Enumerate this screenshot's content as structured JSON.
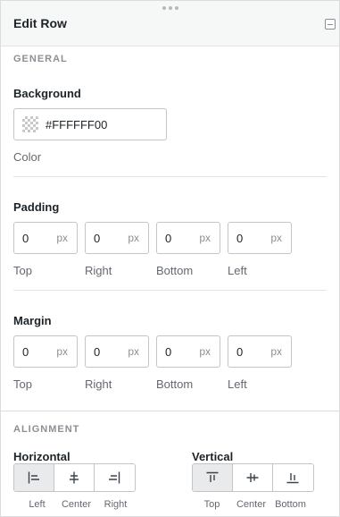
{
  "panel": {
    "title": "Edit Row"
  },
  "general": {
    "section_label": "GENERAL",
    "background_label": "Background",
    "color_value": "#FFFFFF00",
    "color_sub_label": "Color"
  },
  "padding": {
    "label": "Padding",
    "fields": [
      {
        "value": "0",
        "unit": "px",
        "caption": "Top"
      },
      {
        "value": "0",
        "unit": "px",
        "caption": "Right"
      },
      {
        "value": "0",
        "unit": "px",
        "caption": "Bottom"
      },
      {
        "value": "0",
        "unit": "px",
        "caption": "Left"
      }
    ]
  },
  "margin": {
    "label": "Margin",
    "fields": [
      {
        "value": "0",
        "unit": "px",
        "caption": "Top"
      },
      {
        "value": "0",
        "unit": "px",
        "caption": "Right"
      },
      {
        "value": "0",
        "unit": "px",
        "caption": "Bottom"
      },
      {
        "value": "0",
        "unit": "px",
        "caption": "Left"
      }
    ]
  },
  "alignment": {
    "section_label": "ALIGNMENT",
    "horizontal": {
      "label": "Horizontal",
      "selected": "Left",
      "options": [
        {
          "caption": "Left",
          "icon": "align-left-icon"
        },
        {
          "caption": "Center",
          "icon": "align-center-icon"
        },
        {
          "caption": "Right",
          "icon": "align-right-icon"
        }
      ]
    },
    "vertical": {
      "label": "Vertical",
      "selected": "Top",
      "options": [
        {
          "caption": "Top",
          "icon": "align-top-icon"
        },
        {
          "caption": "Center",
          "icon": "align-middle-icon"
        },
        {
          "caption": "Bottom",
          "icon": "align-bottom-icon"
        }
      ]
    }
  },
  "colors": {
    "header_bg": "#f6f7f7",
    "active_button_bg": "#e8eaeb",
    "section_label": "#8c8f94"
  }
}
